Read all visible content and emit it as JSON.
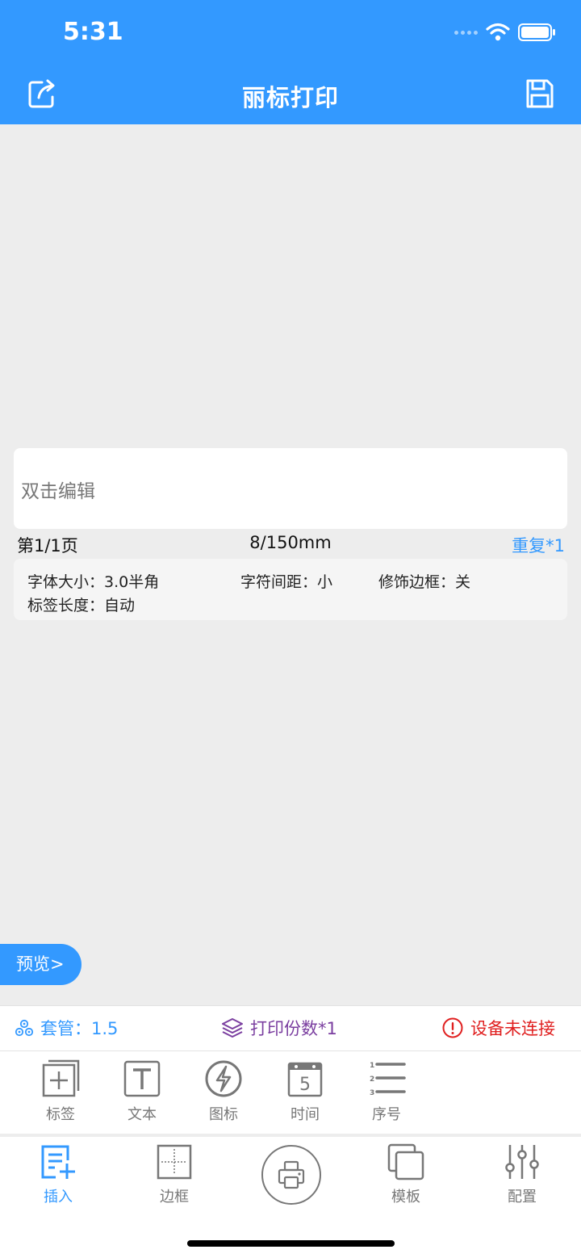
{
  "status_bar": {
    "time": "5:31"
  },
  "header": {
    "title": "丽标打印"
  },
  "editor": {
    "placeholder": "双击编辑",
    "page_info": "第1/1页",
    "size_info": "8/150mm",
    "repeat": "重复*1"
  },
  "settings": {
    "font_size": "字体大小：3.0半角",
    "char_spacing": "字符间距：小",
    "decor_border": "修饰边框：关",
    "label_length": "标签长度：自动"
  },
  "preview_button": "预览>",
  "info_bar": {
    "sleeve": "套管：1.5",
    "copies": "打印份数*1",
    "device_status": "设备未连接"
  },
  "tools": [
    {
      "label": "标签",
      "icon": "label-add-icon"
    },
    {
      "label": "文本",
      "icon": "text-icon"
    },
    {
      "label": "图标",
      "icon": "lightning-icon"
    },
    {
      "label": "时间",
      "icon": "calendar-icon"
    },
    {
      "label": "序号",
      "icon": "numbered-list-icon"
    }
  ],
  "tabs": [
    {
      "label": "插入",
      "icon": "insert-icon",
      "active": true
    },
    {
      "label": "边框",
      "icon": "border-icon"
    },
    {
      "label": "模板",
      "icon": "template-icon"
    },
    {
      "label": "配置",
      "icon": "sliders-icon"
    }
  ],
  "colors": {
    "primary": "#3399ff",
    "background": "#ededed",
    "copies": "#7b3fa0",
    "error": "#e02020",
    "icon_gray": "#777777"
  }
}
